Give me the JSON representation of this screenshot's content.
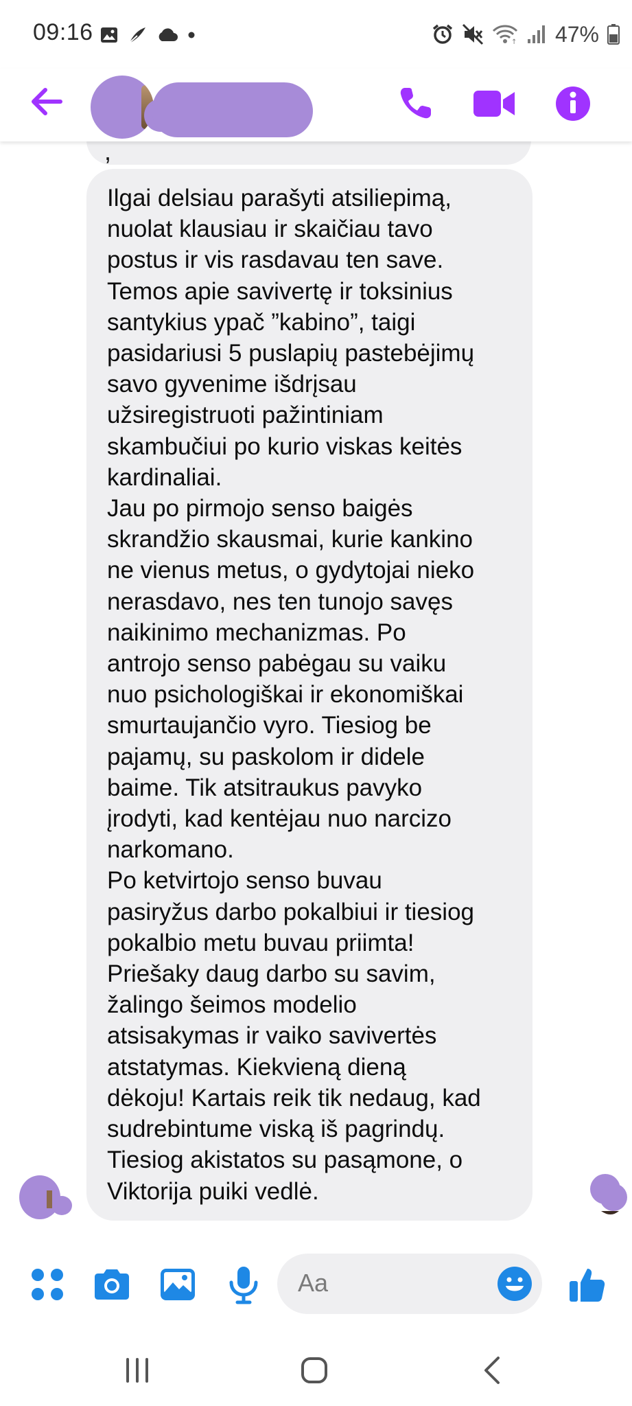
{
  "status_bar": {
    "time": "09:16",
    "left_icons": [
      "image-icon",
      "feather-icon",
      "cloud-icon",
      "dot-icon"
    ],
    "right_icons": [
      "alarm-icon",
      "mute-icon",
      "wifi-icon",
      "signal-icon",
      "battery-icon"
    ],
    "battery": "47%"
  },
  "header": {
    "contact_name": "",
    "actions": [
      "phone-icon",
      "video-icon",
      "info-icon"
    ],
    "accent": "#a033ff"
  },
  "conversation": {
    "previous_message_tail": ",",
    "message": "Ilgai delsiau parašyti atsiliepimą,\nnuolat klausiau ir skaičiau tavo\npostus ir vis rasdavau ten save.\nTemos apie savivertę ir toksinius\nsantykius ypač ”kabino”, taigi\npasidariusi 5 puslapių pastebėjimų\nsavo gyvenime išdrįsau\nužsiregistruoti pažintiniam\nskambučiui po kurio viskas keitės\nkardinaliai.\nJau po pirmojo senso baigės\nskrandžio skausmai, kurie kankino\nne vienus metus, o gydytojai nieko\nnerasdavo, nes ten tunojo savęs\nnaikinimo mechanizmas. Po\nantrojo senso pabėgau su vaiku\nnuo psichologiškai ir ekonomiškai\nsmurtaujančio vyro. Tiesiog be\npajamų, su paskolom ir didele\nbaime. Tik atsitraukus pavyko\nįrodyti, kad kentėjau nuo narcizo\nnarkomano.\nPo ketvirtojo senso buvau\npasiryžus darbo pokalbiui ir tiesiog\npokalbio metu buvau priimta!\nPriešaky daug darbo su savim,\nžalingo šeimos modelio\natsisakymas ir vaiko savivertės\natstatymas. Kiekvieną dieną\ndėkoju! Kartais reik tik nedaug, kad\nsudrebintume viską iš pagrindų.\nTiesiog akistatos su pasąmone, o\nViktorija puiki vedlė.",
    "bubble_color": "#efeff1"
  },
  "composer": {
    "placeholder": "Aa",
    "icons": [
      "apps-icon",
      "camera-icon",
      "gallery-icon",
      "mic-icon",
      "emoji-icon",
      "thumbs-up-icon"
    ],
    "accent": "#1e88e5"
  },
  "nav_bar": {
    "buttons": [
      "recent-apps-icon",
      "home-icon",
      "back-icon"
    ]
  }
}
